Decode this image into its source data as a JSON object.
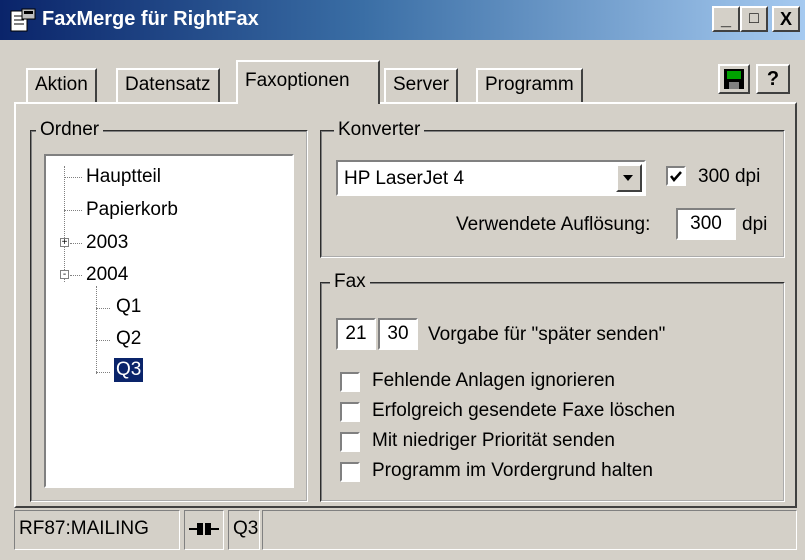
{
  "window": {
    "title": "FaxMerge für RightFax",
    "app_icon": "faxmerge-app-icon",
    "controls": {
      "minimize": "_",
      "maximize": "□",
      "close": "X"
    }
  },
  "tabs": [
    {
      "label": "Aktion",
      "active": false
    },
    {
      "label": "Datensatz",
      "active": false
    },
    {
      "label": "Faxoptionen",
      "active": true
    },
    {
      "label": "Server",
      "active": false
    },
    {
      "label": "Programm",
      "active": false
    }
  ],
  "toolbar": {
    "save_icon": "floppy-disk-icon",
    "help_label": "?"
  },
  "ordner": {
    "legend": "Ordner",
    "items": [
      "Hauptteil",
      "Papierkorb",
      "2003",
      "2004",
      "Q1",
      "Q2",
      "Q3"
    ],
    "expanders": {
      "2003": "+",
      "2004": "-"
    },
    "selected": "Q3"
  },
  "konverter": {
    "legend": "Konverter",
    "selected_printer": "HP LaserJet 4",
    "dpi_checkbox": {
      "checked": true,
      "label": "300 dpi"
    },
    "aufloesung_label": "Verwendete Auflösung:",
    "aufloesung_value": "300",
    "aufloesung_unit": "dpi"
  },
  "fax": {
    "legend": "Fax",
    "hour": "21",
    "minute": "30",
    "later_label": "Vorgabe für \"später senden\"",
    "options": [
      {
        "label": "Fehlende Anlagen ignorieren",
        "checked": false
      },
      {
        "label": "Erfolgreich gesendete Faxe löschen",
        "checked": false
      },
      {
        "label": "Mit niedriger Priorität senden",
        "checked": false
      },
      {
        "label": "Programm im Vordergrund halten",
        "checked": false
      }
    ]
  },
  "statusbar": {
    "server": "RF87:MAILING",
    "connection_icon": "connection-plug-icon",
    "folder": "Q3"
  }
}
